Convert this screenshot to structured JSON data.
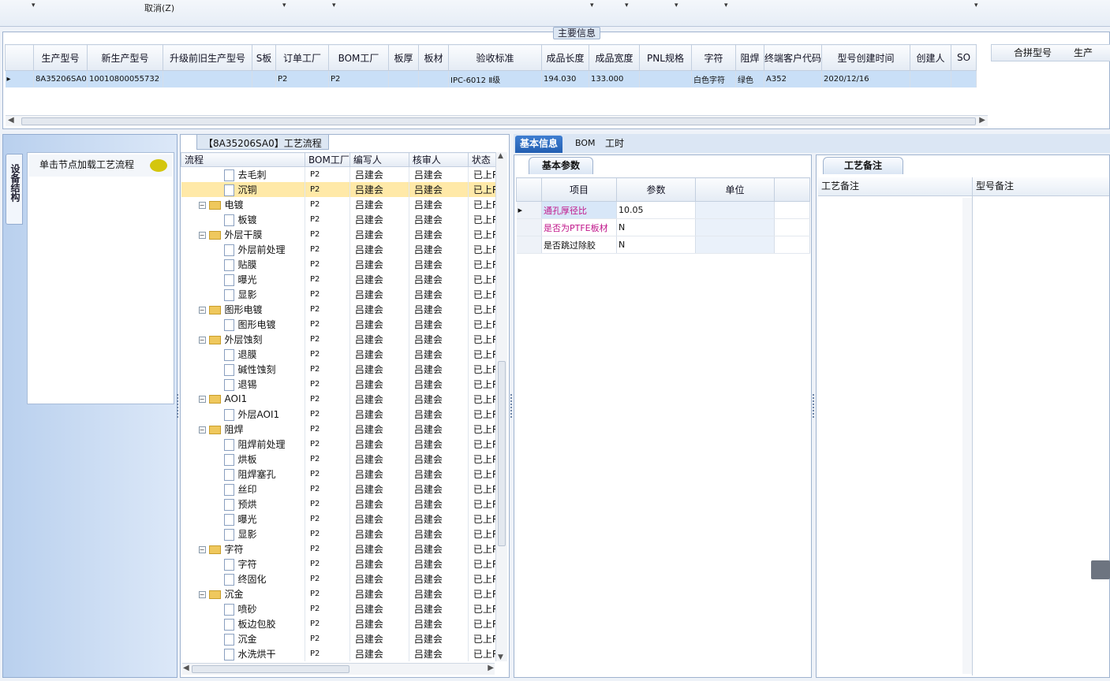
{
  "toolbar": {
    "cancel_label": "取消(Z)"
  },
  "main_info": {
    "title": "主要信息",
    "columns": [
      "生产型号",
      "新生产型号",
      "升级前旧生产型号",
      "S板",
      "订单工厂",
      "BOM工厂",
      "板厚",
      "板材",
      "验收标准",
      "成品长度",
      "成品宽度",
      "PNL规格",
      "字符",
      "阻焊",
      "终端客户代码",
      "型号创建时间",
      "创建人",
      "SO"
    ],
    "row": [
      "8A35206SA0",
      "10010800055732",
      "",
      "",
      "P2",
      "P2",
      "",
      "",
      "IPC-6012 Ⅱ级",
      "194.030",
      "133.000",
      "",
      "白色字符",
      "绿色",
      "A352",
      "2020/12/16",
      "",
      ""
    ],
    "merge_columns": [
      "合拼型号",
      "生产"
    ]
  },
  "left_panel": {
    "vertical_tab": "设备结构",
    "node_hint": "单击节点加载工艺流程"
  },
  "flow": {
    "title": "【8A35206SA0】工艺流程",
    "columns": [
      "流程",
      "BOM工厂",
      "编写人",
      "核审人",
      "状态"
    ],
    "rows": [
      {
        "name": "去毛刺",
        "level": 1,
        "folder": false,
        "factory": "P2",
        "writer": "吕建会",
        "reviewer": "吕建会",
        "status": "已上R"
      },
      {
        "name": "沉铜",
        "level": 1,
        "folder": false,
        "factory": "P2",
        "writer": "吕建会",
        "reviewer": "吕建会",
        "status": "已上R",
        "highlight": true
      },
      {
        "name": "电镀",
        "level": 0,
        "folder": true,
        "factory": "P2",
        "writer": "吕建会",
        "reviewer": "吕建会",
        "status": "已上R"
      },
      {
        "name": "板镀",
        "level": 1,
        "folder": false,
        "factory": "P2",
        "writer": "吕建会",
        "reviewer": "吕建会",
        "status": "已上R"
      },
      {
        "name": "外层干膜",
        "level": 0,
        "folder": true,
        "factory": "P2",
        "writer": "吕建会",
        "reviewer": "吕建会",
        "status": "已上R"
      },
      {
        "name": "外层前处理",
        "level": 1,
        "folder": false,
        "factory": "P2",
        "writer": "吕建会",
        "reviewer": "吕建会",
        "status": "已上R"
      },
      {
        "name": "贴膜",
        "level": 1,
        "folder": false,
        "factory": "P2",
        "writer": "吕建会",
        "reviewer": "吕建会",
        "status": "已上R"
      },
      {
        "name": "曝光",
        "level": 1,
        "folder": false,
        "factory": "P2",
        "writer": "吕建会",
        "reviewer": "吕建会",
        "status": "已上R"
      },
      {
        "name": "显影",
        "level": 1,
        "folder": false,
        "factory": "P2",
        "writer": "吕建会",
        "reviewer": "吕建会",
        "status": "已上R"
      },
      {
        "name": "图形电镀",
        "level": 0,
        "folder": true,
        "factory": "P2",
        "writer": "吕建会",
        "reviewer": "吕建会",
        "status": "已上R"
      },
      {
        "name": "图形电镀",
        "level": 1,
        "folder": false,
        "factory": "P2",
        "writer": "吕建会",
        "reviewer": "吕建会",
        "status": "已上R"
      },
      {
        "name": "外层蚀刻",
        "level": 0,
        "folder": true,
        "factory": "P2",
        "writer": "吕建会",
        "reviewer": "吕建会",
        "status": "已上R"
      },
      {
        "name": "退膜",
        "level": 1,
        "folder": false,
        "factory": "P2",
        "writer": "吕建会",
        "reviewer": "吕建会",
        "status": "已上R"
      },
      {
        "name": "碱性蚀刻",
        "level": 1,
        "folder": false,
        "factory": "P2",
        "writer": "吕建会",
        "reviewer": "吕建会",
        "status": "已上R"
      },
      {
        "name": "退锡",
        "level": 1,
        "folder": false,
        "factory": "P2",
        "writer": "吕建会",
        "reviewer": "吕建会",
        "status": "已上R"
      },
      {
        "name": "AOI1",
        "level": 0,
        "folder": true,
        "factory": "P2",
        "writer": "吕建会",
        "reviewer": "吕建会",
        "status": "已上R"
      },
      {
        "name": "外层AOI1",
        "level": 1,
        "folder": false,
        "factory": "P2",
        "writer": "吕建会",
        "reviewer": "吕建会",
        "status": "已上R"
      },
      {
        "name": "阻焊",
        "level": 0,
        "folder": true,
        "factory": "P2",
        "writer": "吕建会",
        "reviewer": "吕建会",
        "status": "已上R"
      },
      {
        "name": "阻焊前处理",
        "level": 1,
        "folder": false,
        "factory": "P2",
        "writer": "吕建会",
        "reviewer": "吕建会",
        "status": "已上R"
      },
      {
        "name": "烘板",
        "level": 1,
        "folder": false,
        "factory": "P2",
        "writer": "吕建会",
        "reviewer": "吕建会",
        "status": "已上R"
      },
      {
        "name": "阻焊塞孔",
        "level": 1,
        "folder": false,
        "factory": "P2",
        "writer": "吕建会",
        "reviewer": "吕建会",
        "status": "已上R"
      },
      {
        "name": "丝印",
        "level": 1,
        "folder": false,
        "factory": "P2",
        "writer": "吕建会",
        "reviewer": "吕建会",
        "status": "已上R"
      },
      {
        "name": "预烘",
        "level": 1,
        "folder": false,
        "factory": "P2",
        "writer": "吕建会",
        "reviewer": "吕建会",
        "status": "已上R"
      },
      {
        "name": "曝光",
        "level": 1,
        "folder": false,
        "factory": "P2",
        "writer": "吕建会",
        "reviewer": "吕建会",
        "status": "已上R"
      },
      {
        "name": "显影",
        "level": 1,
        "folder": false,
        "factory": "P2",
        "writer": "吕建会",
        "reviewer": "吕建会",
        "status": "已上R"
      },
      {
        "name": "字符",
        "level": 0,
        "folder": true,
        "factory": "P2",
        "writer": "吕建会",
        "reviewer": "吕建会",
        "status": "已上R"
      },
      {
        "name": "字符",
        "level": 1,
        "folder": false,
        "factory": "P2",
        "writer": "吕建会",
        "reviewer": "吕建会",
        "status": "已上R"
      },
      {
        "name": "终固化",
        "level": 1,
        "folder": false,
        "factory": "P2",
        "writer": "吕建会",
        "reviewer": "吕建会",
        "status": "已上R"
      },
      {
        "name": "沉金",
        "level": 0,
        "folder": true,
        "factory": "P2",
        "writer": "吕建会",
        "reviewer": "吕建会",
        "status": "已上R"
      },
      {
        "name": "喷砂",
        "level": 1,
        "folder": false,
        "factory": "P2",
        "writer": "吕建会",
        "reviewer": "吕建会",
        "status": "已上R"
      },
      {
        "name": "板边包胶",
        "level": 1,
        "folder": false,
        "factory": "P2",
        "writer": "吕建会",
        "reviewer": "吕建会",
        "status": "已上R"
      },
      {
        "name": "沉金",
        "level": 1,
        "folder": false,
        "factory": "P2",
        "writer": "吕建会",
        "reviewer": "吕建会",
        "status": "已上R"
      },
      {
        "name": "水洗烘干",
        "level": 1,
        "folder": false,
        "factory": "P2",
        "writer": "吕建会",
        "reviewer": "吕建会",
        "status": "已上R"
      }
    ]
  },
  "right_tabs": [
    "基本信息",
    "BOM",
    "工时"
  ],
  "basic": {
    "subtab": "基本参数",
    "columns": [
      "项目",
      "参数",
      "单位"
    ],
    "rows": [
      {
        "item": "通孔厚径比",
        "value": "10.05",
        "unit": "",
        "pink": true
      },
      {
        "item": "是否为PTFE板材",
        "value": "N",
        "unit": "",
        "pink": true
      },
      {
        "item": "是否跳过除胶",
        "value": "N",
        "unit": "",
        "pink": false
      }
    ]
  },
  "remarks": {
    "subtab": "工艺备注",
    "col1": "工艺备注",
    "col2": "型号备注"
  },
  "colors": {
    "selected_row": "#c9dff7",
    "highlight_row": "#ffe9a8",
    "active_tab": "#2d68bd",
    "pink_text": "#c0158a"
  }
}
